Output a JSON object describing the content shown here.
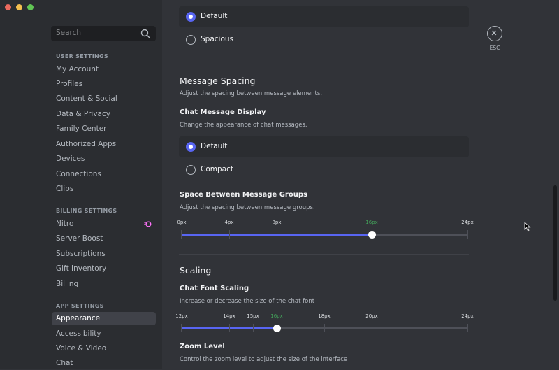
{
  "window": {
    "traffic_lights": [
      "#ec6a5e",
      "#f4bf4f",
      "#61c554"
    ]
  },
  "sidebar": {
    "search_placeholder": "Search",
    "sections": [
      {
        "header": "USER SETTINGS",
        "items": [
          "My Account",
          "Profiles",
          "Content & Social",
          "Data & Privacy",
          "Family Center",
          "Authorized Apps",
          "Devices",
          "Connections",
          "Clips"
        ]
      },
      {
        "header": "BILLING SETTINGS",
        "items": [
          "Nitro",
          "Server Boost",
          "Subscriptions",
          "Gift Inventory",
          "Billing"
        ]
      },
      {
        "header": "APP SETTINGS",
        "items": [
          "Appearance",
          "Accessibility",
          "Voice & Video",
          "Chat"
        ]
      }
    ],
    "active_item": "Appearance"
  },
  "close": {
    "label": "ESC"
  },
  "density_options": [
    {
      "label": "Default",
      "selected": true
    },
    {
      "label": "Spacious",
      "selected": false
    }
  ],
  "message_spacing": {
    "title": "Message Spacing",
    "description": "Adjust the spacing between message elements.",
    "display_title": "Chat Message Display",
    "display_description": "Change the appearance of chat messages.",
    "display_options": [
      {
        "label": "Default",
        "selected": true
      },
      {
        "label": "Compact",
        "selected": false
      }
    ],
    "groups_title": "Space Between Message Groups",
    "groups_description": "Adjust the spacing between message groups.",
    "groups_slider": {
      "ticks": [
        "0px",
        "4px",
        "8px",
        "16px",
        "24px"
      ],
      "value": "16px"
    }
  },
  "scaling": {
    "title": "Scaling",
    "font_title": "Chat Font Scaling",
    "font_description": "Increase or decrease the size of the chat font",
    "font_slider": {
      "ticks": [
        "12px",
        "14px",
        "15px",
        "16px",
        "18px",
        "20px",
        "24px"
      ],
      "value": "16px"
    },
    "zoom_title": "Zoom Level",
    "zoom_description": "Control the zoom level to adjust the size of the interface"
  },
  "colors": {
    "accent": "#5865f2",
    "active_tick": "#43a25a",
    "nitro": "#ff73fa"
  }
}
